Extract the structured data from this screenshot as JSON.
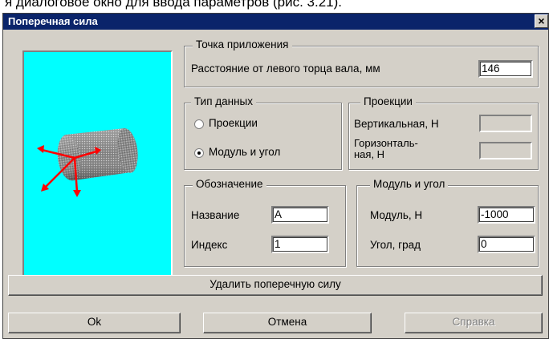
{
  "caption": "я диалоговое окно для ввода параметров (рис. 3.21).",
  "dialog": {
    "title": "Поперечная сила",
    "close": "×"
  },
  "point": {
    "legend": "Точка приложения",
    "distance_label": "Расстояние от левого торца вала, мм",
    "distance_value": "146"
  },
  "data_type": {
    "legend": "Тип данных",
    "option1": "Проекции",
    "option2": "Модуль и угол",
    "selected": "Модуль и угол"
  },
  "projections": {
    "legend": "Проекции",
    "vertical_label": "Вертикальная, Н",
    "vertical_value": "",
    "horizontal_label_1": "Горизонталь-",
    "horizontal_label_2": "ная, Н",
    "horizontal_value": ""
  },
  "designation": {
    "legend": "Обозначение",
    "name_label": "Название",
    "name_value": "A",
    "index_label": "Индекс",
    "index_value": "1"
  },
  "module_angle": {
    "legend": "Модуль и угол",
    "module_label": "Модуль, Н",
    "module_value": "-1000",
    "angle_label": "Угол, град",
    "angle_value": "0"
  },
  "buttons": {
    "delete": "Удалить поперечную силу",
    "ok": "Ok",
    "cancel": "Отмена",
    "help": "Справка"
  },
  "colors": {
    "titlebar": "#0a246a",
    "preview_bg": "#00ffff",
    "arrows": "#ff0000",
    "face": "#d4d0c8"
  }
}
